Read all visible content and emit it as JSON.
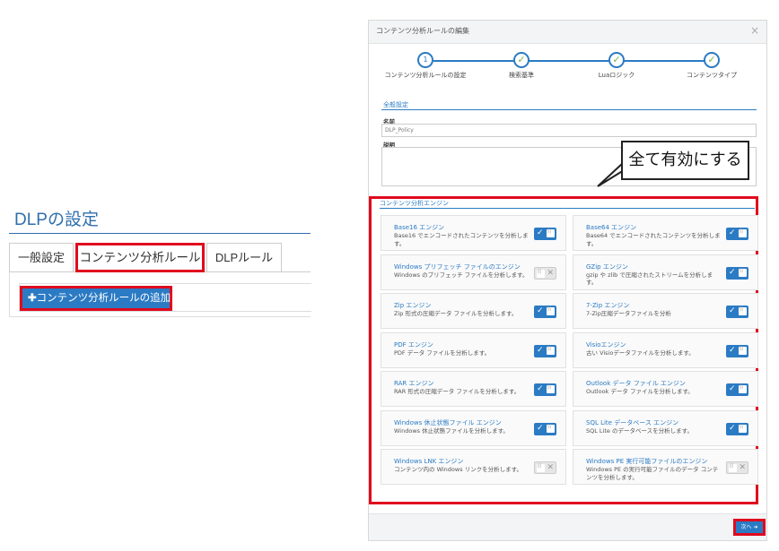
{
  "left": {
    "title": "DLPの設定",
    "tabs": [
      {
        "label": "一般設定"
      },
      {
        "label": "コンテンツ分析ルール"
      },
      {
        "label": "DLPルール"
      }
    ],
    "add_button_label": "コンテンツ分析ルールの追加"
  },
  "modal": {
    "title": "コンテンツ分析ルールの編集",
    "close_symbol": "×",
    "steps": [
      {
        "number": "1",
        "label": "コンテンツ分析ルールの設定"
      },
      {
        "label": "検索基準"
      },
      {
        "label": "Luaロジック"
      },
      {
        "label": "コンテンツタイプ"
      }
    ],
    "general_section": "全般設定",
    "name_label": "名前",
    "name_value": "DLP_Policy",
    "description_label": "説明",
    "engines_section": "コンテンツ分析エンジン",
    "engines": [
      {
        "title": "Base16 エンジン",
        "desc": "Base16 でエンコードされたコンテンツを分析します。",
        "enabled": true
      },
      {
        "title": "Base64 エンジン",
        "desc": "Base64 でエンコードされたコンテンツを分析します。",
        "enabled": true
      },
      {
        "title": "Windows プリフェッチ ファイルのエンジン",
        "desc": "Windows のプリフェッチ ファイルを分析します。",
        "enabled": false
      },
      {
        "title": "GZip エンジン",
        "desc": "gzip や zlib で圧縮されたストリームを分析します。",
        "enabled": true
      },
      {
        "title": "Zip エンジン",
        "desc": "Zip 形式の圧縮データ ファイルを分析します。",
        "enabled": true
      },
      {
        "title": "7-Zip エンジン",
        "desc": "7-Zip圧縮データファイルを分析",
        "enabled": true
      },
      {
        "title": "PDF エンジン",
        "desc": "PDF データ ファイルを分析します。",
        "enabled": true
      },
      {
        "title": "Visioエンジン",
        "desc": "古い Visioデータファイルを分析します。",
        "enabled": true
      },
      {
        "title": "RAR エンジン",
        "desc": "RAR 形式の圧縮データ ファイルを分析します。",
        "enabled": true
      },
      {
        "title": "Outlook データ ファイル エンジン",
        "desc": "Outlook データ ファイルを分析します。",
        "enabled": true
      },
      {
        "title": "Windows 休止状態ファイル エンジン",
        "desc": "Windows 休止状態ファイルを分析します。",
        "enabled": true
      },
      {
        "title": "SQL Lite データベース エンジン",
        "desc": "SQL Lite のデータベースを分析します。",
        "enabled": true
      },
      {
        "title": "Windows LNK エンジン",
        "desc": "コンテンツ内の Windows リンクを分析します。",
        "enabled": false
      },
      {
        "title": "Windows PE 実行可能ファイルのエンジン",
        "desc": "Windows PE の実行可能ファイルのデータ コンテンツを分析します。",
        "enabled": false
      }
    ],
    "next_label": "次へ ➜"
  },
  "callout_text": "全て有効にする",
  "colors": {
    "accent": "#2b7bc4",
    "highlight": "#e00a1e",
    "check": "#7cb342"
  }
}
